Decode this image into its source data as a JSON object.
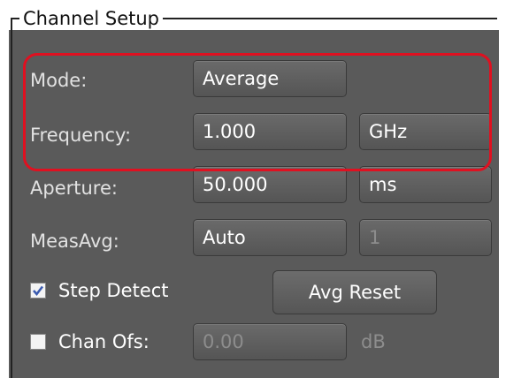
{
  "group": {
    "title": "Channel Setup"
  },
  "rows": {
    "mode": {
      "label": "Mode:",
      "value": "Average"
    },
    "frequency": {
      "label": "Frequency:",
      "value": "1.000",
      "unit": "GHz"
    },
    "aperture": {
      "label": "Aperture:",
      "value": "50.000",
      "unit": "ms"
    },
    "measavg": {
      "label": "MeasAvg:",
      "value": "Auto",
      "count": "1"
    }
  },
  "step_detect": {
    "label": "Step Detect",
    "checked": true
  },
  "avg_reset": {
    "label": "Avg Reset"
  },
  "chan_ofs": {
    "label": "Chan Ofs:",
    "value": "0.00",
    "unit": "dB",
    "checked": false
  },
  "colors": {
    "panel": "#5a5a5a",
    "highlight": "#e01020",
    "text": "#e2e2e2",
    "disabled_text": "#8d8d8d"
  }
}
